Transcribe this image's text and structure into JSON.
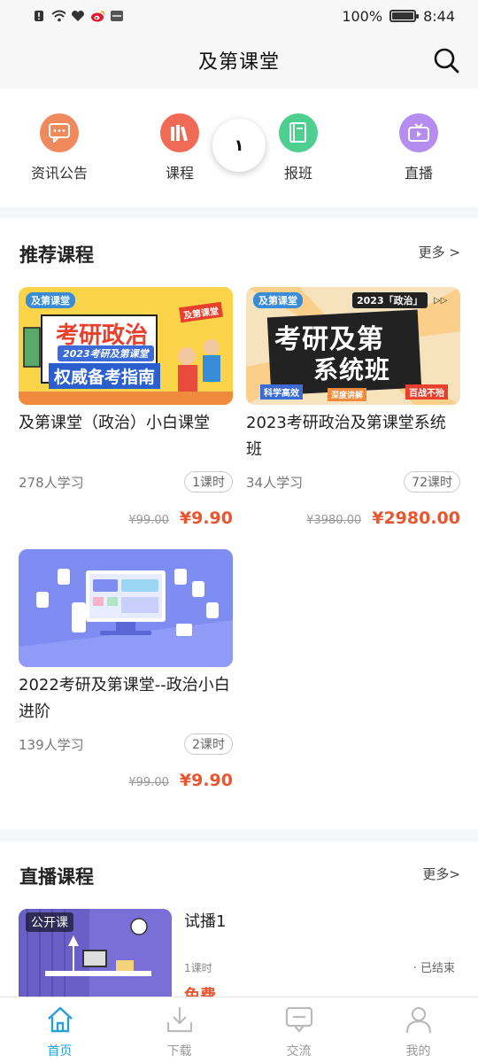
{
  "status_bar": {
    "battery": "100%",
    "time": "8:44",
    "battery_level": 1.0
  },
  "header": {
    "title": "及第课堂"
  },
  "quick_nav": [
    {
      "label": "资讯公告",
      "color": "#f08a5d",
      "icon": "message-icon"
    },
    {
      "label": "课程",
      "color": "#f06a56",
      "icon": "books-icon"
    },
    {
      "label": "报班",
      "color": "#4fcf8f",
      "icon": "book-icon"
    },
    {
      "label": "直播",
      "color": "#b58cf0",
      "icon": "tv-icon"
    }
  ],
  "float_button": {
    "label": "١"
  },
  "recommended": {
    "title": "推荐课程",
    "more": "更多 >",
    "courses": [
      {
        "name": "及第课堂（政治）小白课堂",
        "learners": "278人学习",
        "lessons": "1课时",
        "original_price": "¥99.00",
        "price": "¥9.90",
        "thumb_logo": "及第课堂",
        "thumb_title": "考研政治",
        "thumb_sub": "2023考研及第课堂",
        "thumb_tag": "权威备考指南",
        "thumb_badge": "及第课堂"
      },
      {
        "name": "2023考研政治及第课堂系统班",
        "learners": "34人学习",
        "lessons": "72课时",
        "original_price": "¥3980.00",
        "price": "¥2980.00",
        "thumb_logo": "及第课堂",
        "thumb_badge": "2023「政治」",
        "thumb_line1": "考研及第",
        "thumb_line2": "系统班",
        "thumb_tags": [
          "科学高效",
          "深度讲解",
          "百战不殆"
        ]
      },
      {
        "name": "2022考研及第课堂--政治小白进阶",
        "learners": "139人学习",
        "lessons": "2课时",
        "original_price": "¥99.00",
        "price": "¥9.90"
      }
    ]
  },
  "live": {
    "title": "直播课程",
    "more": "更多>",
    "items": [
      {
        "tag": "公开课",
        "name": "试播1",
        "lessons": "1课时",
        "status": "· 已结束",
        "price": "免费"
      }
    ]
  },
  "tabs": [
    {
      "label": "首页",
      "icon": "home-icon",
      "active": true
    },
    {
      "label": "下载",
      "icon": "download-icon",
      "active": false
    },
    {
      "label": "交流",
      "icon": "chat-icon",
      "active": false
    },
    {
      "label": "我的",
      "icon": "user-icon",
      "active": false
    }
  ]
}
